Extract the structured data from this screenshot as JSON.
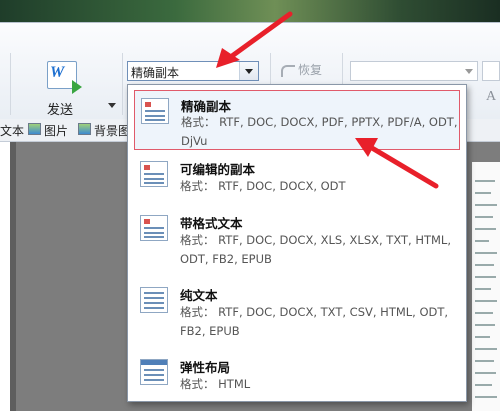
{
  "ribbon": {
    "send_label": "发送",
    "combo_value": "精确副本",
    "restore_label": "恢复"
  },
  "toolbar2": {
    "items": [
      {
        "label": "文本",
        "icon": "text-icon"
      },
      {
        "label": "图片",
        "icon": "picture-icon"
      },
      {
        "label": "背景图",
        "icon": "background-image-icon"
      }
    ]
  },
  "dropdown": {
    "items": [
      {
        "title": "精确副本",
        "formats": "格式： RTF, DOC, DOCX, PDF, PPTX, PDF/A, ODT, DjVu",
        "selected": true,
        "icon": "exact-copy-icon"
      },
      {
        "title": "可编辑的副本",
        "formats": "格式： RTF, DOC, DOCX, ODT",
        "selected": false,
        "icon": "editable-copy-icon"
      },
      {
        "title": "带格式文本",
        "formats": "格式： RTF, DOC, DOCX, XLS, XLSX, TXT, HTML, ODT, FB2, EPUB",
        "selected": false,
        "icon": "formatted-text-icon"
      },
      {
        "title": "纯文本",
        "formats": "格式： RTF, DOC, DOCX, TXT, CSV, HTML, ODT, FB2, EPUB",
        "selected": false,
        "icon": "plain-text-icon"
      },
      {
        "title": "弹性布局",
        "formats": "格式： HTML",
        "selected": false,
        "icon": "flexible-layout-icon"
      }
    ]
  },
  "colors": {
    "annotation_red": "#e8202a",
    "selected_border": "#e05a6a",
    "send_icon_blue": "#1d6fd0"
  }
}
